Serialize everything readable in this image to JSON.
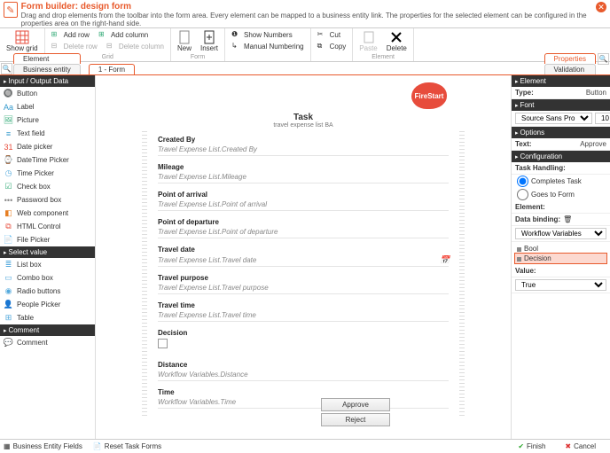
{
  "header": {
    "title": "Form builder: design form",
    "subtitle": "Drag and drop elements from the toolbar into the form area. Every element can be mapped to a business entity link. The properties for the selected element can be configured in the properties area on the right-hand side."
  },
  "ribbon": {
    "showGrid": "Show grid",
    "addRow": "Add row",
    "deleteRow": "Delete row",
    "addColumn": "Add column",
    "deleteColumn": "Delete column",
    "gridGroup": "Grid",
    "new": "New",
    "insert": "Insert",
    "formGroup": "Form",
    "showNumbers": "Show Numbers",
    "manualNumbering": "Manual Numbering",
    "cut": "Cut",
    "copy": "Copy",
    "paste": "Paste",
    "delete": "Delete",
    "elementGroup": "Element"
  },
  "tabs": {
    "left": [
      "Element",
      "Business entity"
    ],
    "center": "1 - Form",
    "right": [
      "Properties",
      "Validation"
    ]
  },
  "toolbox": {
    "groups": [
      {
        "title": "Input / Output Data",
        "items": [
          {
            "label": "Button",
            "icon": "🔘",
            "c": "#5b8"
          },
          {
            "label": "Label",
            "icon": "Aa",
            "c": "#39c"
          },
          {
            "label": "Picture",
            "icon": "🖼",
            "c": "#3a7"
          },
          {
            "label": "Text field",
            "icon": "≡",
            "c": "#39c"
          },
          {
            "label": "Date picker",
            "icon": "31",
            "c": "#e74c3c"
          },
          {
            "label": "DateTime Picker",
            "icon": "⌚",
            "c": "#e67e22"
          },
          {
            "label": "Time Picker",
            "icon": "◷",
            "c": "#5ad"
          },
          {
            "label": "Check box",
            "icon": "☑",
            "c": "#3a7"
          },
          {
            "label": "Password box",
            "icon": "•••",
            "c": "#888"
          },
          {
            "label": "Web component",
            "icon": "◧",
            "c": "#e67e22"
          },
          {
            "label": "HTML Control",
            "icon": "⧉",
            "c": "#e74c3c"
          },
          {
            "label": "File Picker",
            "icon": "📄",
            "c": "#5ad"
          }
        ]
      },
      {
        "title": "Select value",
        "items": [
          {
            "label": "List box",
            "icon": "≣",
            "c": "#5ad"
          },
          {
            "label": "Combo box",
            "icon": "▭",
            "c": "#5ad"
          },
          {
            "label": "Radio buttons",
            "icon": "◉",
            "c": "#5ad"
          },
          {
            "label": "People Picker",
            "icon": "👤",
            "c": "#5ad"
          },
          {
            "label": "Table",
            "icon": "⊞",
            "c": "#5ad"
          }
        ]
      },
      {
        "title": "Comment",
        "items": [
          {
            "label": "Comment",
            "icon": "💬",
            "c": "#f1c40f"
          }
        ]
      }
    ]
  },
  "form": {
    "logo": "FireStart",
    "title": "Task",
    "subtitle": "travel expense list BA",
    "fields": [
      {
        "label": "Created By",
        "value": "Travel Expense List.Created By"
      },
      {
        "label": "Mileage",
        "value": "Travel Expense List.Mileage"
      },
      {
        "label": "Point of arrival",
        "value": "Travel Expense List.Point of arrival"
      },
      {
        "label": "Point of departure",
        "value": "Travel Expense List.Point of departure"
      },
      {
        "label": "Travel date",
        "value": "Travel Expense List.Travel date",
        "date": true
      },
      {
        "label": "Travel purpose",
        "value": "Travel Expense List.Travel purpose"
      },
      {
        "label": "Travel time",
        "value": "Travel Expense List.Travel time"
      },
      {
        "label": "Decision",
        "checkbox": true
      },
      {
        "label": "Distance",
        "value": "Workflow Variables.Distance"
      },
      {
        "label": "Time",
        "value": "Workflow Variables.Time"
      }
    ],
    "buttons": [
      "Approve",
      "Reject"
    ]
  },
  "props": {
    "elementHdr": "Element",
    "type": {
      "k": "Type:",
      "v": "Button"
    },
    "fontHdr": "Font",
    "font": {
      "name": "Source Sans Pro",
      "size": "10"
    },
    "optionsHdr": "Options",
    "text": {
      "k": "Text:",
      "v": "Approve"
    },
    "configHdr": "Configuration",
    "taskHandling": "Task Handling:",
    "radio1": "Completes Task",
    "radio2": "Goes to Form",
    "elementLbl": "Element:",
    "dataBinding": "Data binding:",
    "bindingSel": "Workflow Variables",
    "tree": [
      {
        "label": "Bool"
      },
      {
        "label": "Decision",
        "sel": true
      }
    ],
    "valueLbl": "Value:",
    "valueSel": "True"
  },
  "footer": {
    "beFields": "Business Entity Fields",
    "reset": "Reset Task Forms",
    "finish": "Finish",
    "cancel": "Cancel"
  }
}
